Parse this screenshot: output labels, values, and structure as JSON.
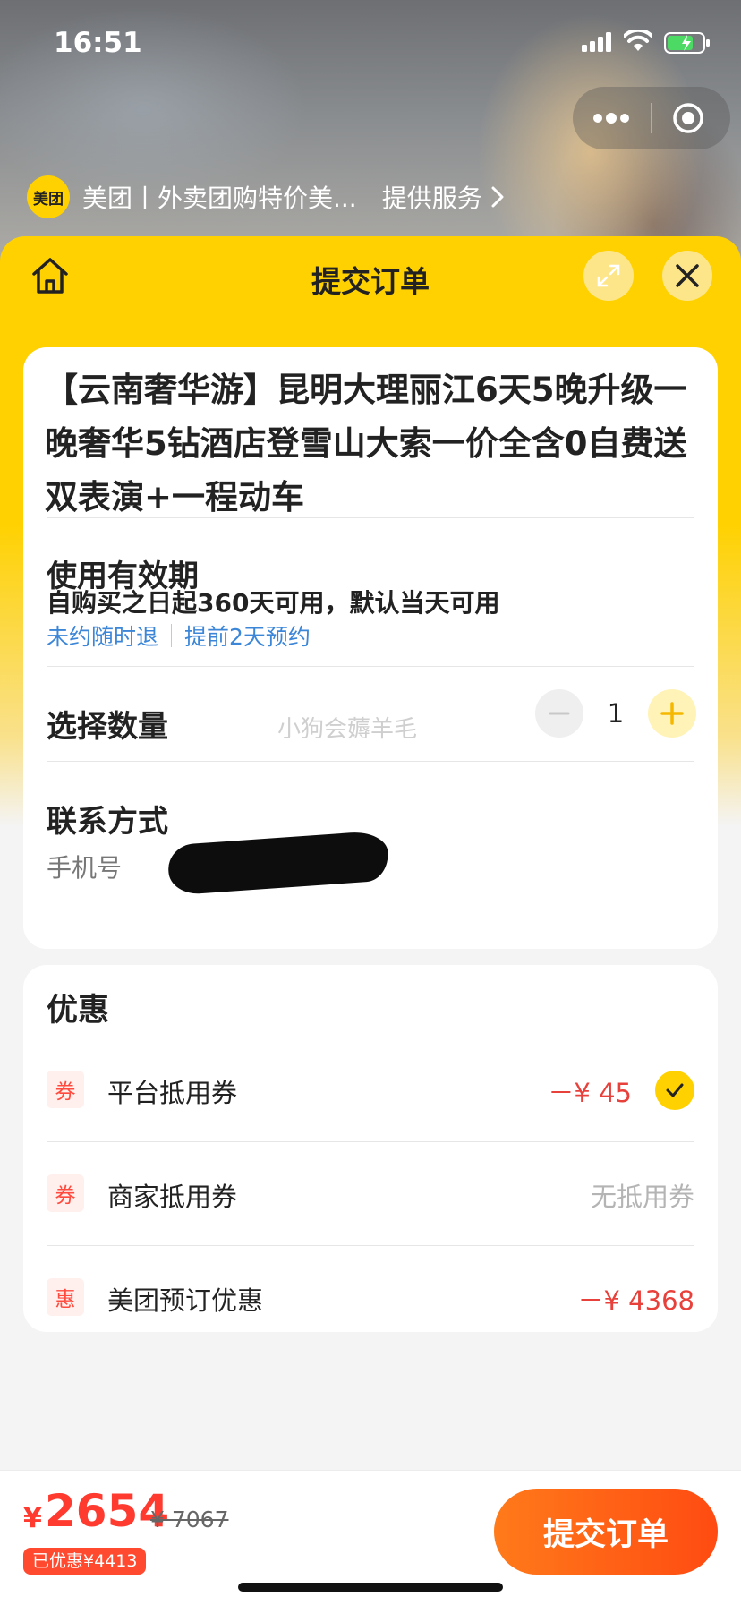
{
  "status_bar": {
    "time": "16:51"
  },
  "service_bar": {
    "logo_text": "美团",
    "name": "美团丨外卖团购特价美...",
    "link_label": "提供服务"
  },
  "sheet": {
    "title": "提交订单"
  },
  "product": {
    "title": "【云南奢华游】昆明大理丽江6天5晚升级一晚奢华5钻酒店登雪山大索一价全含0自费送双表演+一程动车"
  },
  "validity": {
    "label": "使用有效期",
    "text": "自购买之日起360天可用，默认当天可用",
    "tags": [
      "未约随时退",
      "提前2天预约"
    ]
  },
  "quantity": {
    "label": "选择数量",
    "value": "1",
    "watermark": "小狗会薅羊毛"
  },
  "contact": {
    "label": "联系方式",
    "phone_label": "手机号"
  },
  "discounts": {
    "title": "优惠",
    "rows": [
      {
        "badge": "券",
        "name": "平台抵用券",
        "amount": "－¥ 45",
        "checked": true
      },
      {
        "badge": "券",
        "name": "商家抵用券",
        "amount": "无抵用券"
      },
      {
        "badge": "惠",
        "name": "美团预订优惠",
        "amount": "－¥ 4368"
      }
    ]
  },
  "bottom_bar": {
    "currency": "¥",
    "price": "2654",
    "original_price": "¥ 7067",
    "saved": "已优惠¥4413",
    "submit_label": "提交订单"
  },
  "colors": {
    "brand_yellow": "#ffd100",
    "price_red": "#ff3a2f",
    "discount_red": "#e8413b",
    "link_blue": "#3c86d8",
    "submit_orange": "#ff5a14"
  }
}
